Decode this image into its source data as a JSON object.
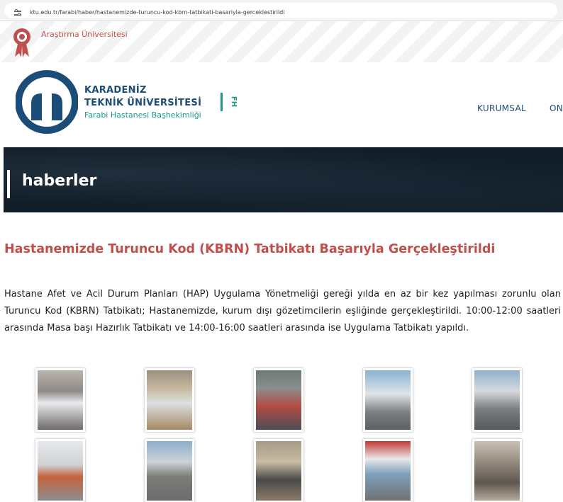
{
  "browser": {
    "url": "ktu.edu.tr/farabi/haber/hastanemizde-turuncu-kod-kbrn-tatbikati-basariyla-gerceklestirildi"
  },
  "top_bar": {
    "research_label": "Araştırma Üniversitesi"
  },
  "header": {
    "uni_name_line1": "KARADENİZ",
    "uni_name_line2": "TEKNİK ÜNİVERSİTESİ",
    "uni_subtitle": "Farabi Hastanesi Başhekimliği",
    "fh_mark": "FH",
    "nav": [
      "KURUMSAL",
      "ON"
    ]
  },
  "page": {
    "section_title": "haberler"
  },
  "article": {
    "title": "Hastanemizde Turuncu Kod (KBRN) Tatbikatı Başarıyla Gerçekleştirildi",
    "body": "Hastane Afet ve Acil Durum Planları (HAP) Uygulama Yönetmeliği gereği yılda en az bir kez yapılması zorunlu olan Turuncu Kod (KBRN) Tatbikatı; Hastanemizde, kurum dışı gözetimcilerin eşliğinde gerçekleştirildi. 10:00-12:00 saatleri arasında Masa başı Hazırlık Tatbikatı ve 14:00-16:00 saatleri arasında ise Uygulama Tatbikatı yapıldı."
  },
  "colors": {
    "brand_navy": "#1c4c78",
    "brand_teal": "#1a9a8c",
    "accent_red": "#c0504d",
    "band_dark": "#111d28"
  },
  "gallery": {
    "rows": 2,
    "columns": 5,
    "photo_count": 10
  }
}
